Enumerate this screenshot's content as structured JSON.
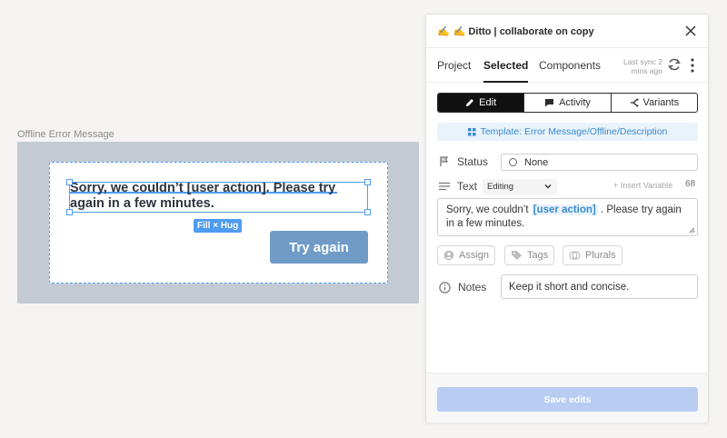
{
  "canvas": {
    "frame_label": "Offline Error Message",
    "error_text": "Sorry, we couldn’t [user action]. Please try again in a few minutes.",
    "size_chip": "Fill × Hug",
    "try_again_label": "Try again"
  },
  "panel": {
    "title_emoji": "✍️",
    "title": "✍️ Ditto | collaborate on copy",
    "tabs": [
      {
        "label": "Project",
        "active": false
      },
      {
        "label": "Selected",
        "active": true
      },
      {
        "label": "Components",
        "active": false
      }
    ],
    "sync_text": "Last sync 2 mins ago",
    "modes": [
      {
        "label": "Edit",
        "icon": "pencil-icon",
        "active": true
      },
      {
        "label": "Activity",
        "icon": "comment-icon",
        "active": false
      },
      {
        "label": "Variants",
        "icon": "branch-icon",
        "active": false
      }
    ],
    "template_label": "Template: Error Message/Offline/Description",
    "status": {
      "label": "Status",
      "value": "None"
    },
    "text_field": {
      "label": "Text",
      "mode": "Editing",
      "insert_variable": "+ Insert Variable",
      "char_count": "68",
      "before": "Sorry, we couldn’t ",
      "variable": "[user action]",
      "after": " . Please try again in a few minutes."
    },
    "pills": {
      "assign": "Assign",
      "tags": "Tags",
      "plurals": "Plurals"
    },
    "notes": {
      "label": "Notes",
      "value": "Keep it short and concise."
    },
    "save_label": "Save edits"
  },
  "colors": {
    "accent": "#4e9cf0",
    "try_again_bg": "#6f9bc6",
    "save_disabled": "#b9cdf3",
    "variable_blue": "#3a8bd0"
  }
}
